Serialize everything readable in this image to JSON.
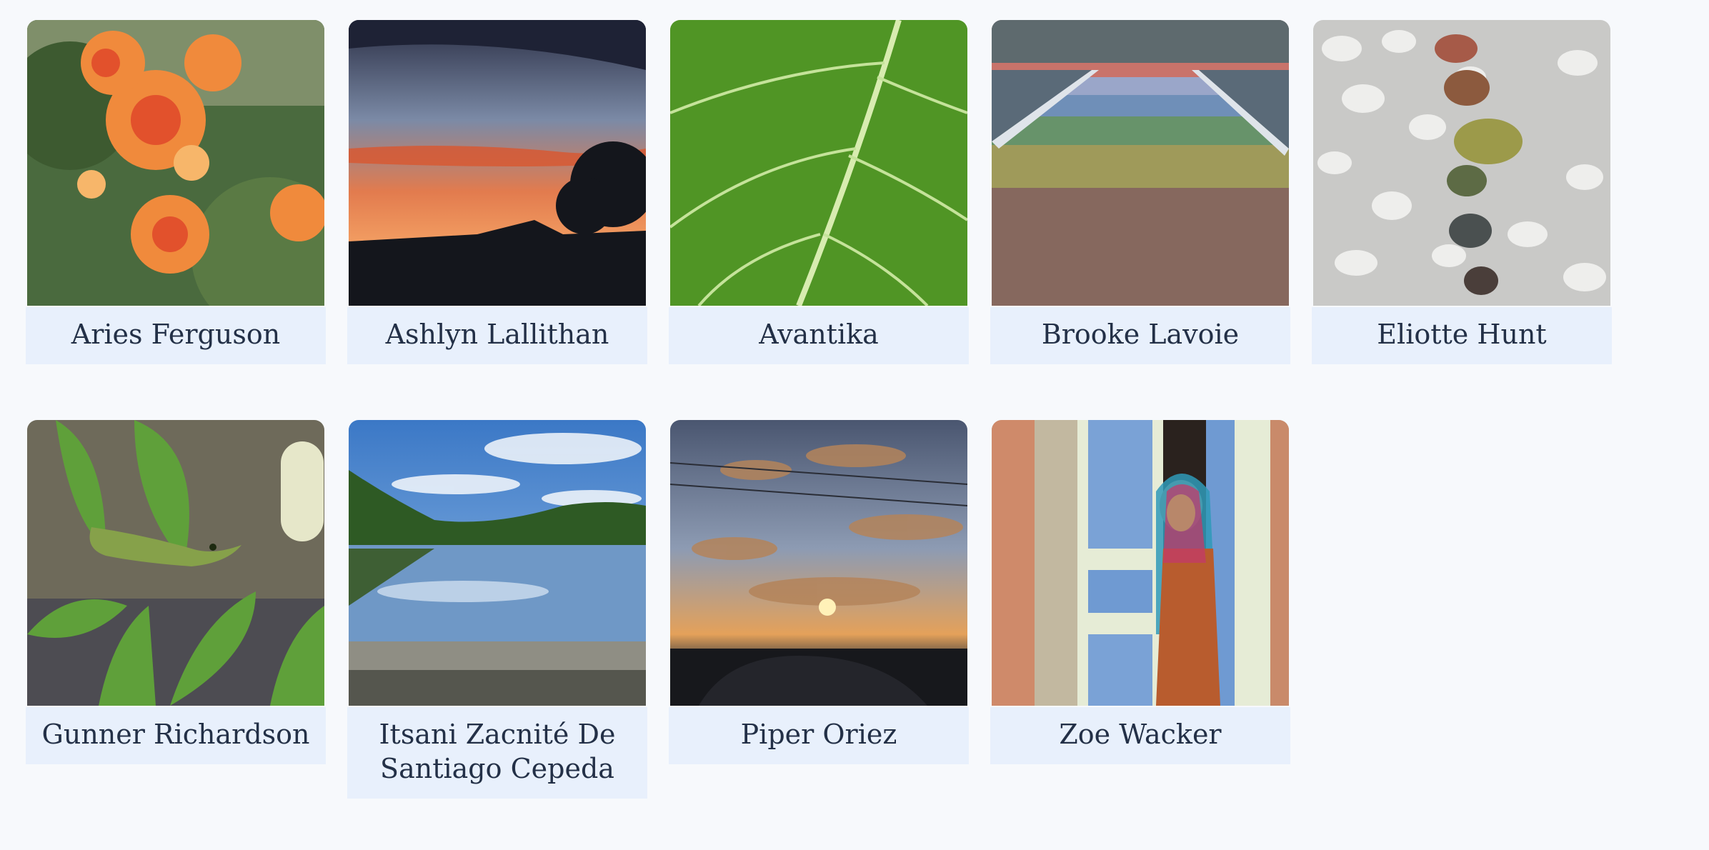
{
  "gallery": {
    "items": [
      {
        "name": "Aries Ferguson",
        "image": "orange-flowers-photo"
      },
      {
        "name": "Ashlyn Lallithan",
        "image": "sunset-sky-photo"
      },
      {
        "name": "Avantika",
        "image": "green-leaf-photo"
      },
      {
        "name": "Brooke Lavoie",
        "image": "rainbow-crosswalk-photo"
      },
      {
        "name": "Eliotte Hunt",
        "image": "gravel-stones-photo"
      },
      {
        "name": "Gunner Richardson",
        "image": "lizard-plant-photo"
      },
      {
        "name": "Itsani Zacnité De Santiago Cepeda",
        "image": "river-reflection-photo"
      },
      {
        "name": "Piper Oriez",
        "image": "cloudy-sunset-photo"
      },
      {
        "name": "Zoe Wacker",
        "image": "blue-door-woman-photo"
      }
    ]
  },
  "colors": {
    "page_background": "#f7f9fc",
    "caption_background": "#e8f0fc",
    "caption_text": "#233047"
  }
}
